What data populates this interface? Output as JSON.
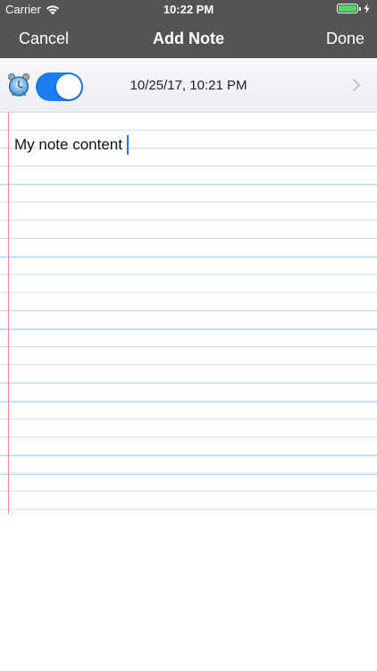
{
  "status_bar": {
    "carrier": "Carrier",
    "time": "10:22 PM",
    "battery_color": "#4cd964"
  },
  "nav": {
    "left_label": "Cancel",
    "title": "Add Note",
    "right_label": "Done",
    "bar_color": "#545454"
  },
  "reminder": {
    "icon": "alarm-clock-icon",
    "enabled": true,
    "toggle_color": "#1a7ef2",
    "datetime": "10/25/17, 10:21 PM"
  },
  "note": {
    "content": "My note content",
    "line_color": "#b8dcf2",
    "margin_color": "#f08a86"
  }
}
